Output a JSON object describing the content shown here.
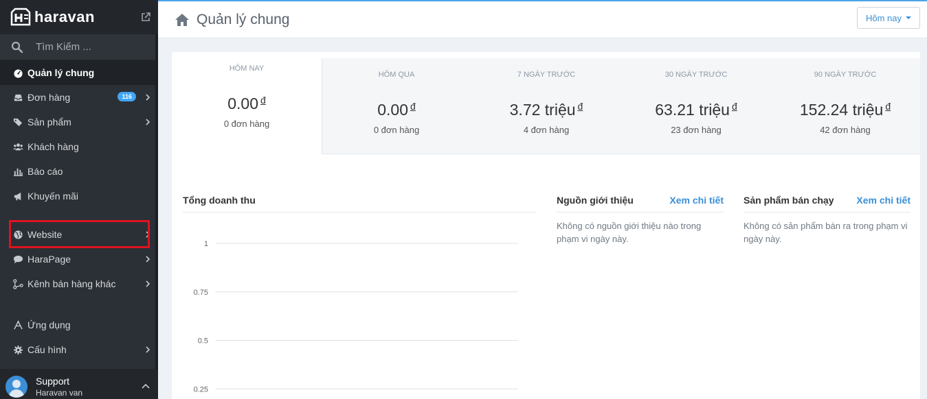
{
  "brand": {
    "name": "haravan"
  },
  "search": {
    "placeholder": "Tìm Kiếm ..."
  },
  "nav": {
    "dashboard": "Quản lý chung",
    "orders": "Đơn hàng",
    "orders_badge": "116",
    "products": "Sản phẩm",
    "customers": "Khách hàng",
    "reports": "Báo cáo",
    "promotions": "Khuyến mãi",
    "website": "Website",
    "harapage": "HaraPage",
    "other_channels": "Kênh bán hàng khác",
    "apps": "Ứng dụng",
    "settings": "Cấu hình"
  },
  "support": {
    "name": "Support",
    "sub": "Haravan van"
  },
  "header": {
    "title": "Quản lý chung",
    "range_select": "Hôm nay"
  },
  "stats": [
    {
      "label": "HÔM NAY",
      "value": "0.00",
      "currency": "đ",
      "orders": "0 đơn hàng"
    },
    {
      "label": "HÔM QUA",
      "value": "0.00",
      "currency": "đ",
      "orders": "0 đơn hàng"
    },
    {
      "label": "7 NGÀY TRƯỚC",
      "value": "3.72 triệu",
      "currency": "đ",
      "orders": "4 đơn hàng"
    },
    {
      "label": "30 NGÀY TRƯỚC",
      "value": "63.21 triệu",
      "currency": "đ",
      "orders": "23 đơn hàng"
    },
    {
      "label": "90 NGÀY TRƯỚC",
      "value": "152.24 triệu",
      "currency": "đ",
      "orders": "42 đơn hàng"
    }
  ],
  "revenue": {
    "title": "Tổng doanh thu"
  },
  "referrals": {
    "title": "Nguồn giới thiệu",
    "link": "Xem chi tiết",
    "empty": "Không có nguồn giới thiệu nào trong phạm vi ngày này."
  },
  "best_sellers": {
    "title": "Sản phẩm bán chạy",
    "link": "Xem chi tiết",
    "empty": "Không có sản phẩm bán ra trong phạm vi ngày này."
  },
  "chart_data": {
    "type": "line",
    "title": "Tổng doanh thu",
    "y_ticks": [
      "1",
      "0.75",
      "0.5",
      "0.25"
    ],
    "ylim": [
      0,
      1
    ],
    "grid": true,
    "series": []
  },
  "colors": {
    "accent": "#3b8fd6",
    "sidebar": "#2b3036",
    "highlight": "#e0121f"
  }
}
